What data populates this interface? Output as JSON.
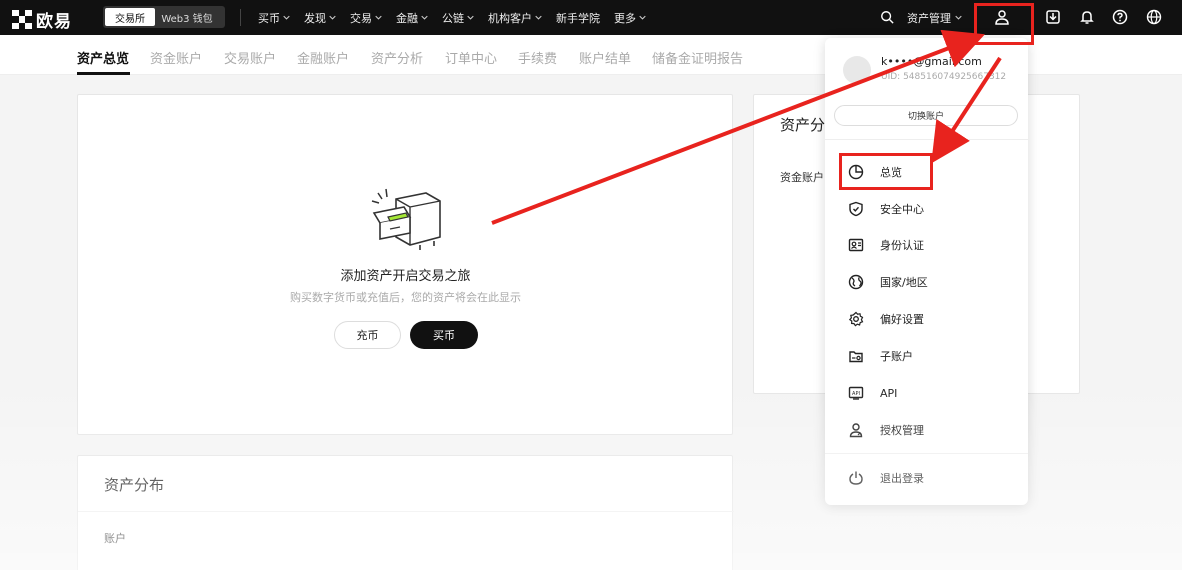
{
  "brand": {
    "name": "欧易"
  },
  "env_switch": {
    "exchange": "交易所",
    "web3": "Web3 钱包"
  },
  "nav": {
    "items": [
      "买币",
      "发现",
      "交易",
      "金融",
      "公链",
      "机构客户",
      "新手学院",
      "更多"
    ],
    "has_chevron": [
      true,
      true,
      true,
      true,
      true,
      true,
      false,
      true
    ],
    "asset_mgmt": "资产管理"
  },
  "subtabs": [
    "资产总览",
    "资金账户",
    "交易账户",
    "金融账户",
    "资产分析",
    "订单中心",
    "手续费",
    "账户结单",
    "储备金证明报告"
  ],
  "overview": {
    "empty_title": "添加资产开启交易之旅",
    "empty_subtitle": "购买数字货币或充值后，您的资产将会在此显示",
    "deposit_button": "充币",
    "buy_button": "买币"
  },
  "distribution": {
    "title": "资产分布",
    "account_label": "账户"
  },
  "right_card": {
    "title": "资产分",
    "label": "资金账户"
  },
  "account_menu": {
    "email": "k••••@gmail.com",
    "uid": "UID: 548516074925667312",
    "switch_button": "切换账户",
    "items": [
      {
        "label": "总览",
        "icon": "pie-chart-icon"
      },
      {
        "label": "安全中心",
        "icon": "shield-icon"
      },
      {
        "label": "身份认证",
        "icon": "id-card-icon"
      },
      {
        "label": "国家/地区",
        "icon": "globe-icon"
      },
      {
        "label": "偏好设置",
        "icon": "gear-icon"
      },
      {
        "label": "子账户",
        "icon": "sub-account-icon"
      },
      {
        "label": "API",
        "icon": "api-icon"
      },
      {
        "label": "授权管理",
        "icon": "authorization-icon"
      },
      {
        "label": "退出登录",
        "icon": "power-icon"
      }
    ]
  },
  "colors": {
    "nav_bg": "#111111",
    "annotation_red": "#e8231e",
    "accent_green": "#a3e635"
  }
}
